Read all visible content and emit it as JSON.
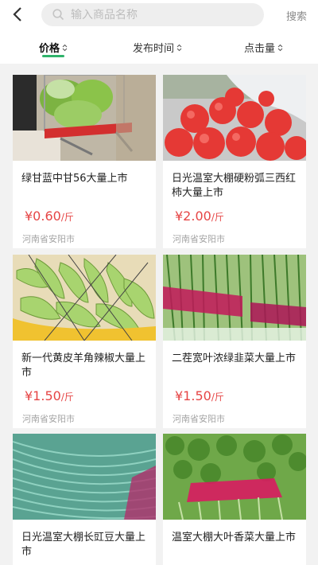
{
  "search": {
    "placeholder": "输入商品名称",
    "button_label": "搜索"
  },
  "sort": [
    {
      "label": "价格",
      "active": true
    },
    {
      "label": "发布时间",
      "active": false
    },
    {
      "label": "点击量",
      "active": false
    }
  ],
  "colors": {
    "accent": "#2fb36a",
    "price": "#e64545"
  },
  "products": [
    {
      "title": "绿甘蓝中甘56大量上市",
      "price": "¥0.60",
      "unit": "/斤",
      "location": "河南省安阳市",
      "image": "cabbage-image"
    },
    {
      "title": "日光温室大棚硬粉弧三西红柿大量上市",
      "price": "¥2.00",
      "unit": "/斤",
      "location": "河南省安阳市",
      "image": "tomato-image"
    },
    {
      "title": "新一代黄皮羊角辣椒大量上市",
      "price": "¥1.50",
      "unit": "/斤",
      "location": "河南省安阳市",
      "image": "pepper-image"
    },
    {
      "title": "二茬宽叶浓绿韭菜大量上市",
      "price": "¥1.50",
      "unit": "/斤",
      "location": "河南省安阳市",
      "image": "chive-image"
    },
    {
      "title": "日光温室大棚长豇豆大量上市",
      "price": "",
      "unit": "",
      "location": "",
      "image": "cowpea-image"
    },
    {
      "title": "温室大棚大叶香菜大量上市",
      "price": "",
      "unit": "",
      "location": "",
      "image": "coriander-image"
    }
  ]
}
